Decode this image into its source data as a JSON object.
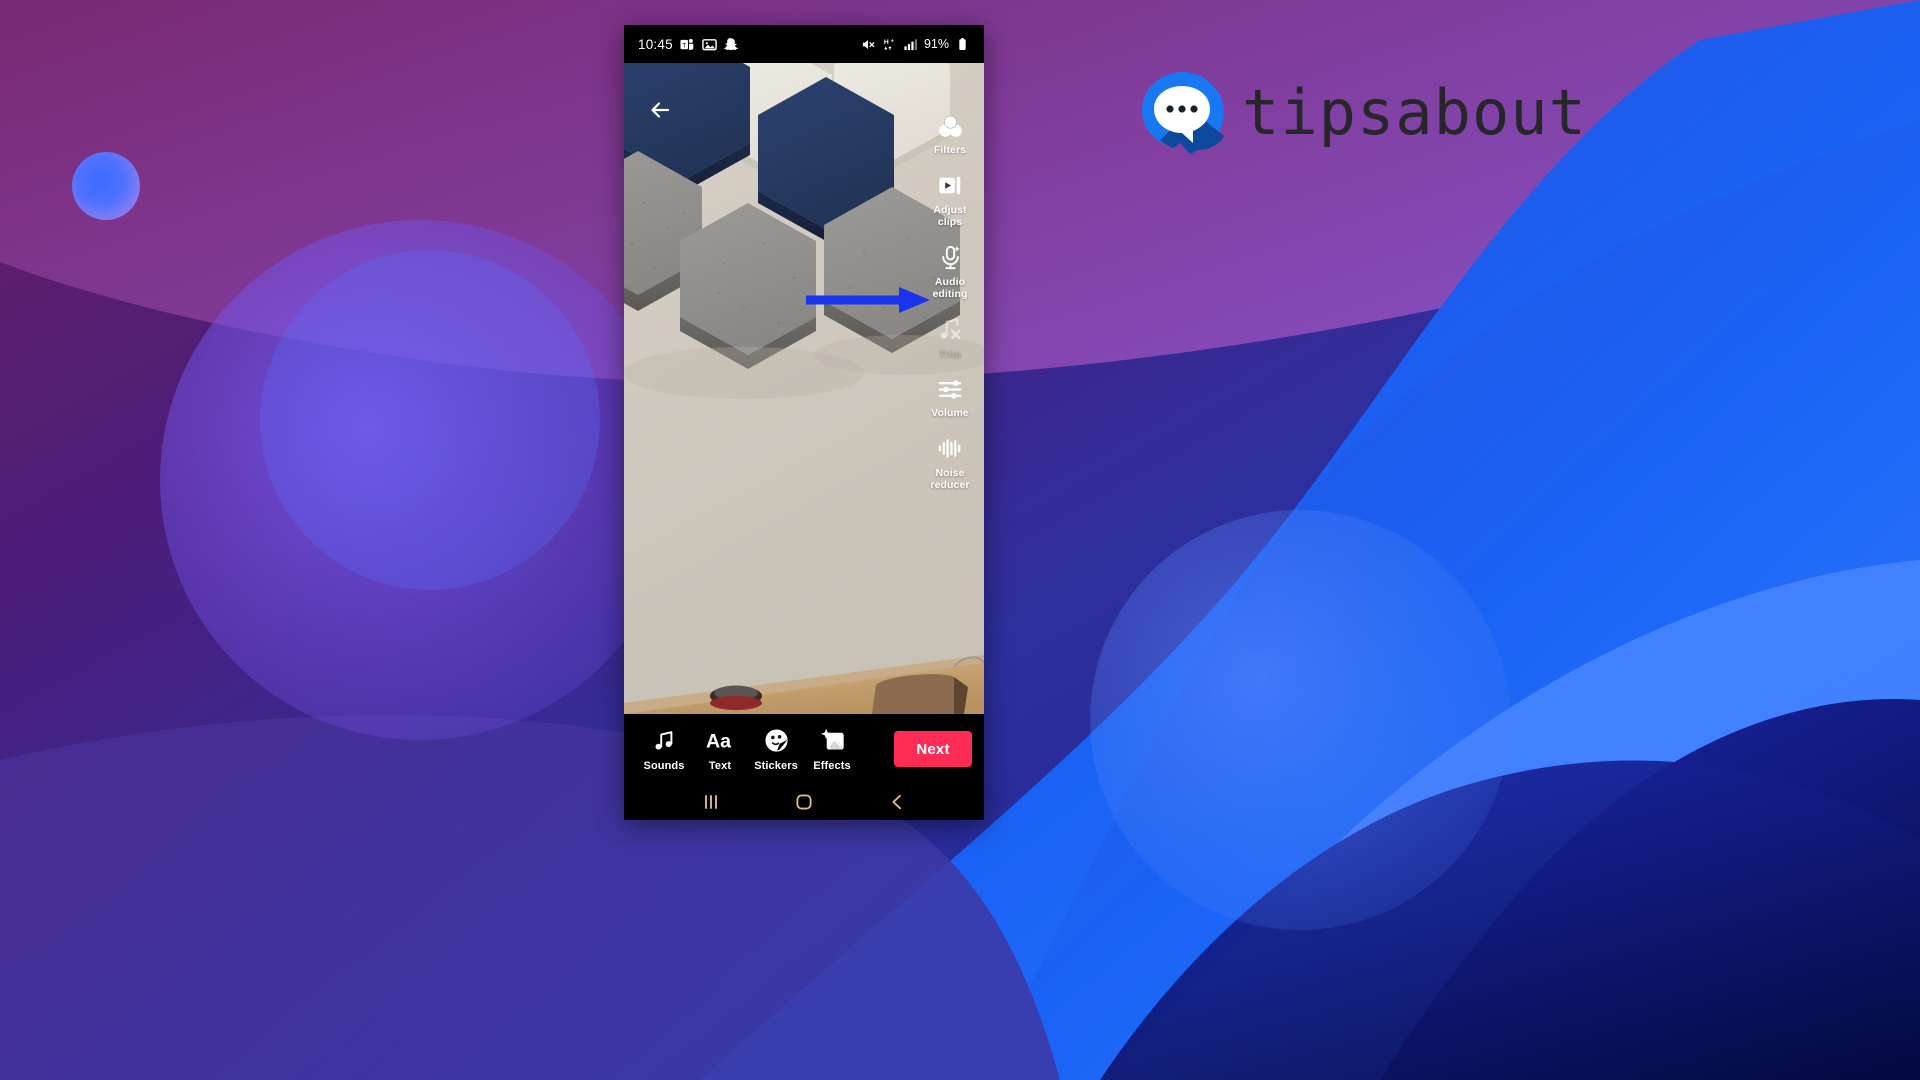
{
  "page": {
    "background_colors": {
      "purple_dark": "#3d1257",
      "magenta": "#6b1f63",
      "violet": "#4a2394",
      "blue": "#1a63f5",
      "blue_light": "#4a8dff",
      "navy_deep": "#0b1063"
    }
  },
  "brand": {
    "name": "tipsabout",
    "logo_icon": "speech-bubble-icon",
    "logo_blue": "#1877F2",
    "logo_shadow": "#0d4a9e",
    "wordmark_color": "#26262b"
  },
  "phone": {
    "status_bar": {
      "time": "10:45",
      "left_icons": [
        "microsoft-teams-icon",
        "gallery-icon",
        "snapchat-icon"
      ],
      "right_icons": [
        "mute-icon",
        "hspa-plus-icon",
        "signal-bars-icon"
      ],
      "battery_percent": "91%",
      "battery_icon": "battery-icon"
    },
    "editor": {
      "back_icon": "back-arrow-icon",
      "tools": [
        {
          "label": "Filters",
          "icon": "filters-icon",
          "disabled": false
        },
        {
          "label": "Adjust\nclips",
          "icon": "adjust-clips-icon",
          "disabled": false
        },
        {
          "label": "Audio\nediting",
          "icon": "audio-editing-icon",
          "disabled": false
        },
        {
          "label": "Trim",
          "icon": "trim-icon",
          "disabled": true
        },
        {
          "label": "Volume",
          "icon": "volume-icon",
          "disabled": false
        },
        {
          "label": "Noise\nreducer",
          "icon": "noise-reducer-icon",
          "disabled": false
        }
      ],
      "annotation": {
        "type": "arrow",
        "points_to": "Audio editing",
        "color": "#1a33ee"
      },
      "preview_description": "Hexagonal acoustic wall panels in navy blue and grey felt on a cream wall above a wooden desk"
    },
    "action_bar": {
      "items": [
        {
          "label": "Sounds",
          "icon": "music-note-icon"
        },
        {
          "label": "Text",
          "icon": "text-aa-icon"
        },
        {
          "label": "Stickers",
          "icon": "sticker-smiley-icon"
        },
        {
          "label": "Effects",
          "icon": "effects-sparkle-icon"
        }
      ],
      "next_label": "Next",
      "next_color": "#FE2C55"
    },
    "nav_bar": {
      "recents_icon": "recents-icon",
      "home_icon": "home-icon",
      "back_icon": "nav-back-icon",
      "tint": "#d9b98f"
    }
  }
}
